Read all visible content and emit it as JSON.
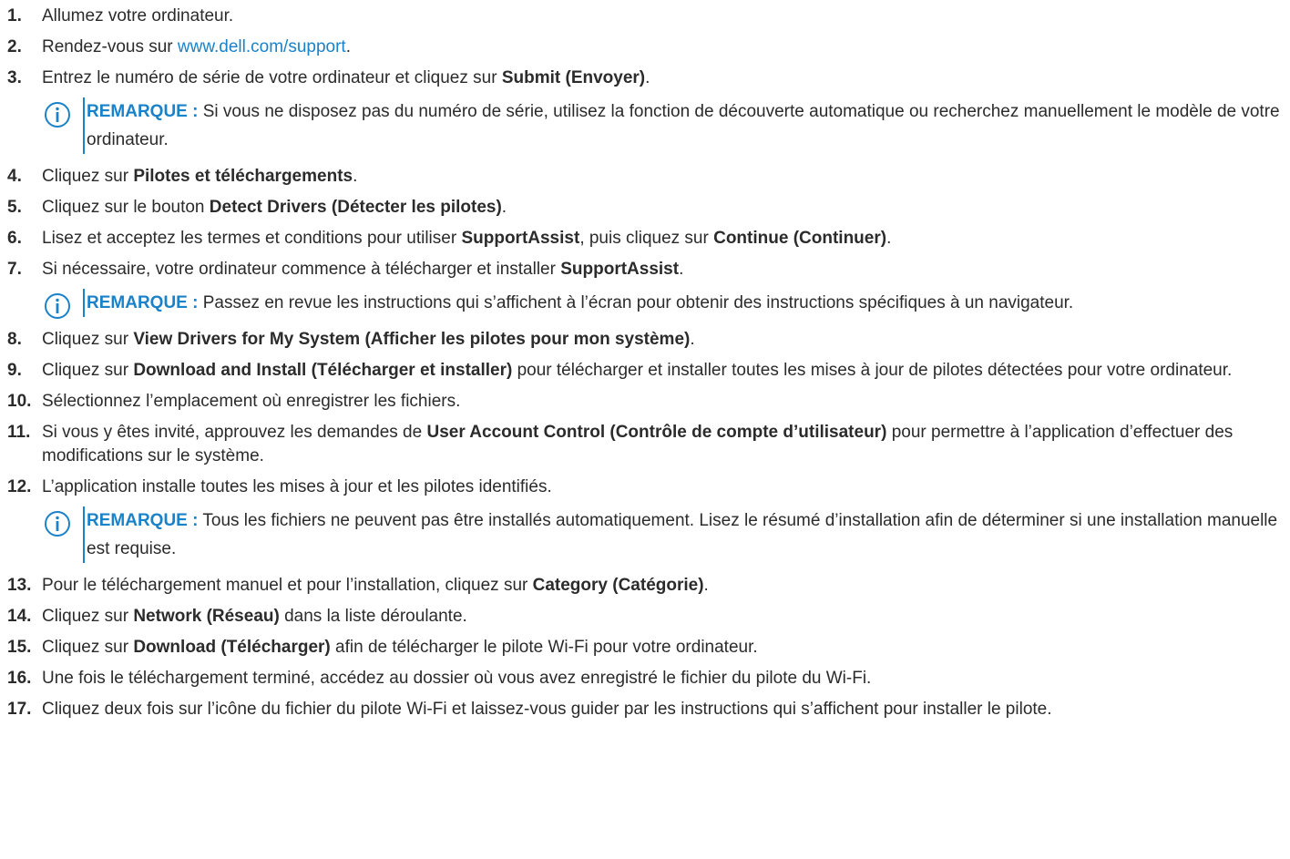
{
  "steps": [
    {
      "num": "1.",
      "parts": [
        {
          "t": "Allumez votre ordinateur."
        }
      ]
    },
    {
      "num": "2.",
      "parts": [
        {
          "t": "Rendez-vous sur "
        },
        {
          "t": "www.dell.com/support",
          "link": true
        },
        {
          "t": "."
        }
      ]
    },
    {
      "num": "3.",
      "parts": [
        {
          "t": "Entrez le numéro de série de votre ordinateur et cliquez sur "
        },
        {
          "t": "Submit (Envoyer)",
          "b": true
        },
        {
          "t": "."
        }
      ],
      "note": {
        "label": "REMARQUE :",
        "text": " Si vous ne disposez pas du numéro de série, utilisez la fonction de découverte automatique ou recherchez manuellement le modèle de votre ordinateur."
      }
    },
    {
      "num": "4.",
      "parts": [
        {
          "t": "Cliquez sur "
        },
        {
          "t": "Pilotes et téléchargements",
          "b": true
        },
        {
          "t": "."
        }
      ]
    },
    {
      "num": "5.",
      "parts": [
        {
          "t": "Cliquez sur le bouton "
        },
        {
          "t": "Detect Drivers (Détecter les pilotes)",
          "b": true
        },
        {
          "t": "."
        }
      ]
    },
    {
      "num": "6.",
      "parts": [
        {
          "t": "Lisez et acceptez les termes et conditions pour utiliser "
        },
        {
          "t": "SupportAssist",
          "b": true
        },
        {
          "t": ", puis cliquez sur "
        },
        {
          "t": "Continue (Continuer)",
          "b": true
        },
        {
          "t": "."
        }
      ]
    },
    {
      "num": "7.",
      "parts": [
        {
          "t": "Si nécessaire, votre ordinateur commence à télécharger et installer "
        },
        {
          "t": "SupportAssist",
          "b": true
        },
        {
          "t": "."
        }
      ],
      "note": {
        "label": "REMARQUE :",
        "text": " Passez en revue les instructions qui s’affichent à l’écran pour obtenir des instructions spécifiques à un navigateur."
      }
    },
    {
      "num": "8.",
      "parts": [
        {
          "t": "Cliquez sur "
        },
        {
          "t": "View Drivers for My System (Afficher les pilotes pour mon système)",
          "b": true
        },
        {
          "t": "."
        }
      ]
    },
    {
      "num": "9.",
      "parts": [
        {
          "t": "Cliquez sur "
        },
        {
          "t": "Download and Install (Télécharger et installer)",
          "b": true
        },
        {
          "t": " pour télécharger et installer toutes les mises à jour de pilotes détectées pour votre ordinateur."
        }
      ]
    },
    {
      "num": "10.",
      "parts": [
        {
          "t": "Sélectionnez l’emplacement où enregistrer les fichiers."
        }
      ]
    },
    {
      "num": "11.",
      "parts": [
        {
          "t": "Si vous y êtes invité, approuvez les demandes de "
        },
        {
          "t": "User Account Control (Contrôle de compte d’utilisateur)",
          "b": true
        },
        {
          "t": " pour permettre à l’application d’effectuer des modifications sur le système."
        }
      ]
    },
    {
      "num": "12.",
      "parts": [
        {
          "t": "L’application installe toutes les mises à jour et les pilotes identifiés."
        }
      ],
      "note": {
        "label": "REMARQUE :",
        "text": " Tous les fichiers ne peuvent pas être installés automatiquement. Lisez le résumé d’installation afin de déterminer si une installation manuelle est requise."
      }
    },
    {
      "num": "13.",
      "parts": [
        {
          "t": "Pour le téléchargement manuel et pour l’installation, cliquez sur "
        },
        {
          "t": "Category (Catégorie)",
          "b": true
        },
        {
          "t": "."
        }
      ]
    },
    {
      "num": "14.",
      "parts": [
        {
          "t": "Cliquez sur "
        },
        {
          "t": "Network (Réseau)",
          "b": true
        },
        {
          "t": " dans la liste déroulante."
        }
      ]
    },
    {
      "num": "15.",
      "parts": [
        {
          "t": "Cliquez sur "
        },
        {
          "t": "Download (Télécharger)",
          "b": true
        },
        {
          "t": " afin de télécharger le pilote Wi-Fi pour votre ordinateur."
        }
      ]
    },
    {
      "num": "16.",
      "parts": [
        {
          "t": "Une fois le téléchargement terminé, accédez au dossier où vous avez enregistré le fichier du pilote du Wi-Fi."
        }
      ]
    },
    {
      "num": "17.",
      "parts": [
        {
          "t": "Cliquez deux fois sur l’icône du fichier du pilote Wi-Fi et laissez-vous guider par les instructions qui s’affichent pour installer le pilote."
        }
      ]
    }
  ],
  "colors": {
    "accent": "#1a82c8",
    "text": "#2b2b2b"
  },
  "icons": {
    "note": "info-icon"
  }
}
